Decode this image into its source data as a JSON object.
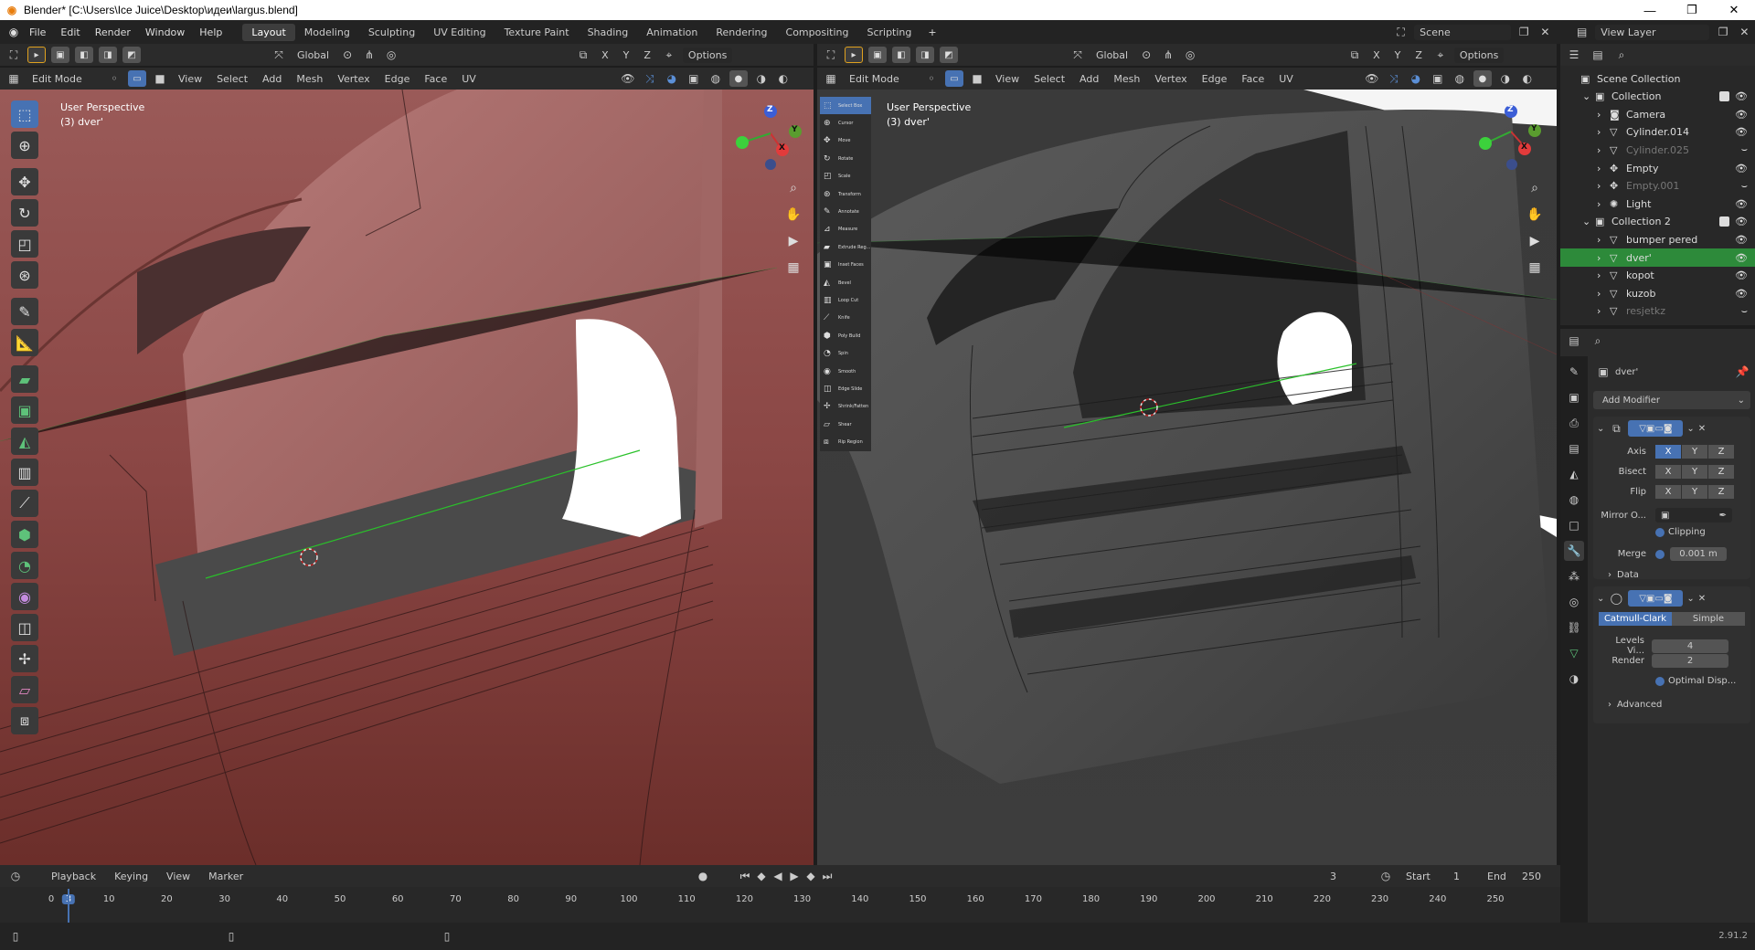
{
  "window": {
    "title": "Blender* [C:\\Users\\Ice Juice\\Desktop\\идеи\\largus.blend]",
    "min_label": "—",
    "max_label": "❐",
    "close_label": "✕"
  },
  "menu": [
    "File",
    "Edit",
    "Render",
    "Window",
    "Help"
  ],
  "workspaces": [
    "Layout",
    "Modeling",
    "Sculpting",
    "UV Editing",
    "Texture Paint",
    "Shading",
    "Animation",
    "Rendering",
    "Compositing",
    "Scripting"
  ],
  "active_workspace": "Layout",
  "add_workspace": "+",
  "scene_field": "Scene",
  "viewlayer_field": "View Layer",
  "viewport_left": {
    "orientation": "Global",
    "options": "Options",
    "xyz": [
      "X",
      "Y",
      "Z"
    ],
    "mode": "Edit Mode",
    "menus": [
      "View",
      "Select",
      "Add",
      "Mesh",
      "Vertex",
      "Edge",
      "Face",
      "UV"
    ],
    "perspective": "User Perspective",
    "object": "(3) dver'"
  },
  "viewport_right": {
    "orientation": "Global",
    "options": "Options",
    "xyz": [
      "X",
      "Y",
      "Z"
    ],
    "mode": "Edit Mode",
    "menus": [
      "View",
      "Select",
      "Add",
      "Mesh",
      "Vertex",
      "Edge",
      "Face",
      "UV"
    ],
    "perspective": "User Perspective",
    "object": "(3) dver'"
  },
  "gizmo": {
    "x": "X",
    "y": "Y",
    "z": "Z"
  },
  "mini_tools": [
    "Select Box",
    "Cursor",
    "Move",
    "Rotate",
    "Scale",
    "Transform",
    "Annotate",
    "Measure",
    "Extrude Reg...",
    "Inset Faces",
    "Bevel",
    "Loop Cut",
    "Knife",
    "Poly Build",
    "Spin",
    "Smooth",
    "Edge Slide",
    "Shrink/Fatten",
    "Shear",
    "Rip Region"
  ],
  "outliner": {
    "rows": [
      {
        "name": "Scene Collection",
        "indent": 0,
        "icon": "▣",
        "sel": false,
        "dim": false
      },
      {
        "name": "Collection",
        "indent": 1,
        "icon": "▣",
        "sel": false,
        "dim": false
      },
      {
        "name": "Camera",
        "indent": 2,
        "icon": "◙",
        "sel": false,
        "dim": false
      },
      {
        "name": "Cylinder.014",
        "indent": 2,
        "icon": "▽",
        "sel": false,
        "dim": false
      },
      {
        "name": "Cylinder.025",
        "indent": 2,
        "icon": "▽",
        "sel": false,
        "dim": true
      },
      {
        "name": "Empty",
        "indent": 2,
        "icon": "✥",
        "sel": false,
        "dim": false
      },
      {
        "name": "Empty.001",
        "indent": 2,
        "icon": "✥",
        "sel": false,
        "dim": true
      },
      {
        "name": "Light",
        "indent": 2,
        "icon": "✺",
        "sel": false,
        "dim": false
      },
      {
        "name": "Collection 2",
        "indent": 1,
        "icon": "▣",
        "sel": false,
        "dim": false
      },
      {
        "name": "bumper pered",
        "indent": 2,
        "icon": "▽",
        "sel": false,
        "dim": false
      },
      {
        "name": "dver'",
        "indent": 2,
        "icon": "▽",
        "sel": true,
        "dim": false
      },
      {
        "name": "kopot",
        "indent": 2,
        "icon": "▽",
        "sel": false,
        "dim": false
      },
      {
        "name": "kuzob",
        "indent": 2,
        "icon": "▽",
        "sel": false,
        "dim": false
      },
      {
        "name": "resjetkz",
        "indent": 2,
        "icon": "▽",
        "sel": false,
        "dim": true
      }
    ]
  },
  "properties": {
    "object_name": "dver'",
    "add_modifier": "Add Modifier",
    "mirror": {
      "axis_label": "Axis",
      "bisect_label": "Bisect",
      "flip_label": "Flip",
      "mirror_obj_label": "Mirror O...",
      "clipping_label": "Clipping",
      "merge_label": "Merge",
      "merge_value": "0.001 m",
      "data_label": "Data"
    },
    "subsurf": {
      "catmull": "Catmull-Clark",
      "simple": "Simple",
      "levels_label": "Levels Vi...",
      "levels_value": "4",
      "render_label": "Render",
      "render_value": "2",
      "optimal_label": "Optimal Disp...",
      "advanced_label": "Advanced"
    }
  },
  "timeline": {
    "menus": [
      "Playback",
      "Keying",
      "View",
      "Marker"
    ],
    "current_frame": "3",
    "start_label": "Start",
    "start_value": "1",
    "end_label": "End",
    "end_value": "250",
    "ticks": [
      "0",
      "3",
      "10",
      "20",
      "30",
      "40",
      "50",
      "60",
      "70",
      "80",
      "90",
      "100",
      "110",
      "120",
      "130",
      "140",
      "150",
      "160",
      "170",
      "180",
      "190",
      "200",
      "210",
      "220",
      "230",
      "240",
      "250"
    ]
  },
  "status": {
    "version": "2.91.2"
  }
}
